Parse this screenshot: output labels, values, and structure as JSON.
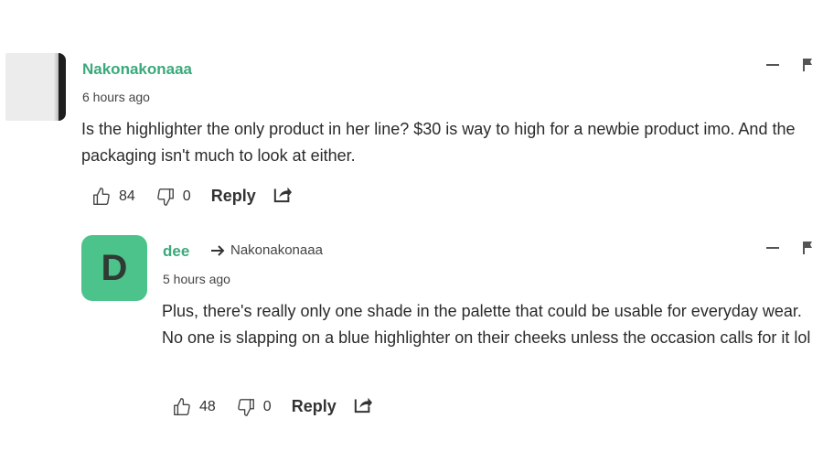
{
  "comments": [
    {
      "author": "Nakonakonaaa",
      "time": "6 hours ago",
      "text": "Is the highlighter the only product in her line? $30 is way to high for a newbie product imo. And the packaging isn't much to look at either.",
      "likes": "84",
      "dislikes": "0",
      "reply_label": "Reply"
    },
    {
      "avatar_letter": "D",
      "author": "dee",
      "reply_to": "Nakonakonaaa",
      "time": "5 hours ago",
      "text": "Plus, there's really only one shade in the palette that could be usable for everyday wear. No one is slapping on a blue highlighter on their cheeks unless the occasion calls for it lol",
      "likes": "48",
      "dislikes": "0",
      "reply_label": "Reply"
    }
  ],
  "colors": {
    "author": "#3aa97b",
    "avatar_bg": "#4cc38a"
  },
  "icons": [
    "thumbs-up-icon",
    "thumbs-down-icon",
    "share-icon",
    "collapse-icon",
    "flag-icon",
    "reply-arrow-icon"
  ]
}
